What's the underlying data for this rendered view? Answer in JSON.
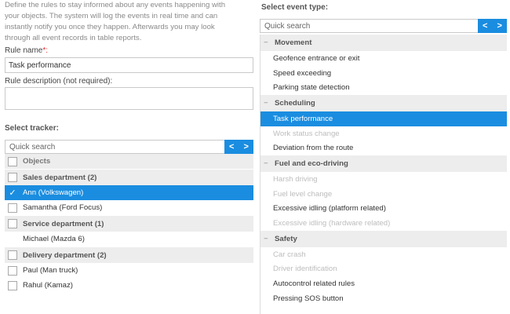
{
  "intro": {
    "line1": "Define the rules to stay informed about any events happening with",
    "line2": "your objects. The system will log the events in real time and can",
    "line3": "instantly notify you once they happen. Afterwards you may look",
    "line4": "through all event records in table reports."
  },
  "rule_name": {
    "label": "Rule name",
    "required_mark": "*:",
    "value": "Task performance"
  },
  "rule_description": {
    "label": "Rule description (not required):",
    "value": ""
  },
  "tracker": {
    "title": "Select tracker:",
    "search_placeholder": "Quick search",
    "prev": "<",
    "next": ">",
    "header": "Objects",
    "rows": [
      {
        "type": "group",
        "label": "Sales department (2)"
      },
      {
        "type": "item",
        "label": "Ann (Volkswagen)",
        "selected": true
      },
      {
        "type": "item",
        "label": "Samantha (Ford Focus)"
      },
      {
        "type": "group",
        "label": "Service department (1)"
      },
      {
        "type": "item-nocb",
        "label": "Michael (Mazda 6)"
      },
      {
        "type": "group",
        "label": "Delivery department (2)"
      },
      {
        "type": "item",
        "label": "Paul (Man truck)"
      },
      {
        "type": "item",
        "label": "Rahul (Kamaz)"
      }
    ]
  },
  "event": {
    "title": "Select event type:",
    "search_placeholder": "Quick search",
    "prev": "<",
    "next": ">",
    "rows": [
      {
        "type": "cat",
        "label": "Movement"
      },
      {
        "type": "item",
        "label": "Geofence entrance or exit"
      },
      {
        "type": "item",
        "label": "Speed exceeding"
      },
      {
        "type": "item",
        "label": "Parking state detection"
      },
      {
        "type": "cat",
        "label": "Scheduling"
      },
      {
        "type": "item",
        "label": "Task performance",
        "selected": true
      },
      {
        "type": "item",
        "label": "Work status change",
        "disabled": true
      },
      {
        "type": "item",
        "label": "Deviation from the route"
      },
      {
        "type": "cat",
        "label": "Fuel and eco-driving"
      },
      {
        "type": "item",
        "label": "Harsh driving",
        "disabled": true
      },
      {
        "type": "item",
        "label": "Fuel level change",
        "disabled": true
      },
      {
        "type": "item",
        "label": "Excessive idling (platform related)"
      },
      {
        "type": "item",
        "label": "Excessive idling (hardware related)",
        "disabled": true
      },
      {
        "type": "cat",
        "label": "Safety"
      },
      {
        "type": "item",
        "label": "Car crash",
        "disabled": true
      },
      {
        "type": "item",
        "label": "Driver identification",
        "disabled": true
      },
      {
        "type": "item",
        "label": "Autocontrol related rules"
      },
      {
        "type": "item",
        "label": "Pressing SOS button"
      }
    ]
  },
  "colors": {
    "accent": "#1a8de0",
    "group_bg": "#ededed",
    "disabled_text": "#bdbdbd",
    "required": "#e03030"
  }
}
